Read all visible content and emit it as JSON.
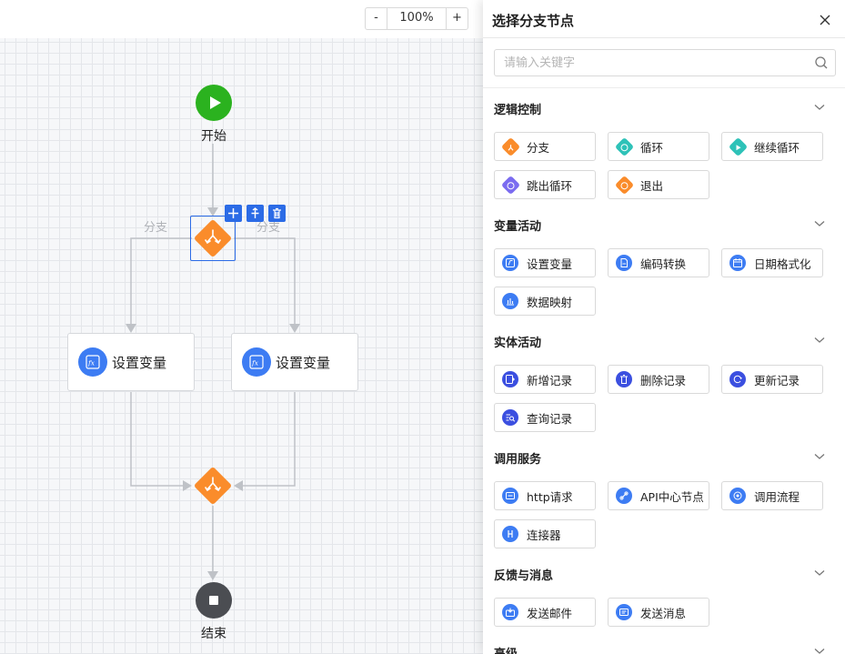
{
  "zoom": {
    "minus": "-",
    "value": "100%",
    "plus": "+"
  },
  "flow": {
    "start_label": "开始",
    "end_label": "结束",
    "branch_left": "分支",
    "branch_right": "分支",
    "left_node": "设置变量",
    "right_node": "设置变量"
  },
  "panel": {
    "title": "选择分支节点",
    "search_placeholder": "请输入关键字",
    "categories": [
      {
        "title": "逻辑控制",
        "items": [
          {
            "label": "分支",
            "icon": "branch-icon",
            "color": "#fa8c2b"
          },
          {
            "label": "循环",
            "icon": "loop-icon",
            "color": "#2ec2b8"
          },
          {
            "label": "继续循环",
            "icon": "continue-loop-icon",
            "color": "#2ec2b8"
          },
          {
            "label": "跳出循环",
            "icon": "break-loop-icon",
            "color": "#7b6cf0"
          },
          {
            "label": "退出",
            "icon": "exit-icon",
            "color": "#fa8c2b"
          }
        ]
      },
      {
        "title": "变量活动",
        "items": [
          {
            "label": "设置变量",
            "icon": "set-variable-icon",
            "color": "#3d7cf3"
          },
          {
            "label": "编码转换",
            "icon": "encoding-icon",
            "color": "#3d7cf3"
          },
          {
            "label": "日期格式化",
            "icon": "calendar-icon",
            "color": "#3d7cf3"
          },
          {
            "label": "数据映射",
            "icon": "data-map-icon",
            "color": "#3d7cf3"
          }
        ]
      },
      {
        "title": "实体活动",
        "items": [
          {
            "label": "新增记录",
            "icon": "add-record-icon",
            "color": "#3b4fe0"
          },
          {
            "label": "删除记录",
            "icon": "delete-record-icon",
            "color": "#3b4fe0"
          },
          {
            "label": "更新记录",
            "icon": "update-record-icon",
            "color": "#3b4fe0"
          },
          {
            "label": "查询记录",
            "icon": "query-record-icon",
            "color": "#3b4fe0"
          }
        ]
      },
      {
        "title": "调用服务",
        "items": [
          {
            "label": "http请求",
            "icon": "http-icon",
            "color": "#3d7cf3"
          },
          {
            "label": "API中心节点",
            "icon": "api-icon",
            "color": "#3d7cf3"
          },
          {
            "label": "调用流程",
            "icon": "call-flow-icon",
            "color": "#3d7cf3"
          },
          {
            "label": "连接器",
            "icon": "connector-icon",
            "color": "#3d7cf3"
          }
        ]
      },
      {
        "title": "反馈与消息",
        "items": [
          {
            "label": "发送邮件",
            "icon": "mail-icon",
            "color": "#3d7cf3"
          },
          {
            "label": "发送消息",
            "icon": "message-icon",
            "color": "#3d7cf3"
          }
        ]
      },
      {
        "title": "高级",
        "items": []
      }
    ]
  }
}
